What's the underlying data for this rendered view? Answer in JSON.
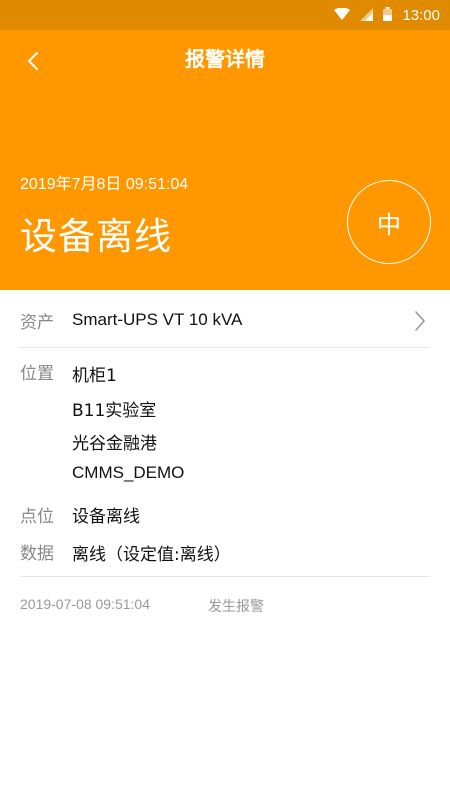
{
  "status_bar": {
    "time": "13:00",
    "icons": [
      "wifi-icon",
      "cellular-signal-icon",
      "battery-icon"
    ]
  },
  "header": {
    "title": "报警详情",
    "datetime": "2019年7月8日 09:51:04",
    "alarm_title": "设备离线",
    "severity": "中",
    "background_color": "#ff9800"
  },
  "details": {
    "asset_label": "资产",
    "asset_value": "Smart-UPS VT 10 kVA",
    "location_label": "位置",
    "location_lines": [
      "机柜1",
      "B11实验室",
      "光谷金融港",
      "CMMS_DEMO"
    ],
    "point_label": "点位",
    "point_value": "设备离线",
    "data_label": "数据",
    "data_value": "离线（设定值:离线）"
  },
  "history": {
    "date": "2019-07-08  09:51:04",
    "event": "发生报警"
  }
}
